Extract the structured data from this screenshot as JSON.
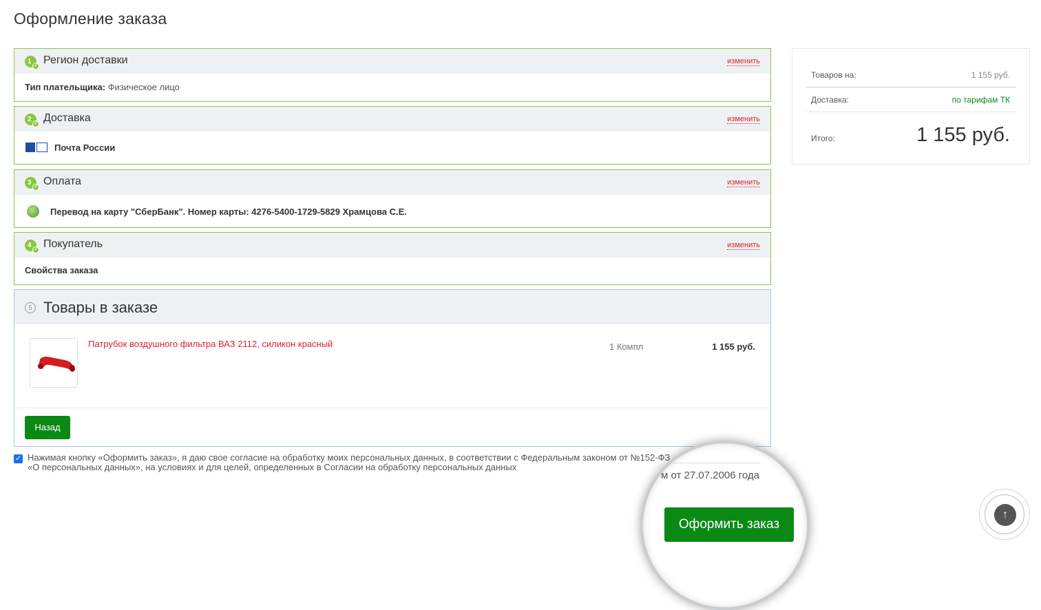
{
  "page": {
    "title": "Оформление заказа"
  },
  "steps": {
    "region": {
      "num": "1",
      "title": "Регион доставки",
      "edit": "изменить",
      "payer_label": "Тип плательщика:",
      "payer_value": "Физическое лицо"
    },
    "delivery": {
      "num": "2",
      "title": "Доставка",
      "edit": "изменить",
      "service": "Почта России"
    },
    "payment": {
      "num": "3",
      "title": "Оплата",
      "edit": "изменить",
      "method": "Перевод на карту \"СберБанк\". Номер карты: 4276-5400-1729-5829 Храмцова С.Е."
    },
    "buyer": {
      "num": "4",
      "title": "Покупатель",
      "edit": "изменить",
      "props": "Свойства заказа"
    }
  },
  "goods": {
    "num": "5",
    "title": "Товары в заказе",
    "items": [
      {
        "name": "Патрубок воздушного фильтра ВАЗ 2112, силикон красный",
        "qty": "1 Компл",
        "price": "1 155 руб."
      }
    ],
    "back_label": "Назад"
  },
  "consent": {
    "checked": true,
    "text": "Нажимая кнопку «Оформить заказ», я даю свое согласие на обработку моих персональных данных, в соответствии с Федеральным законом от №152-ФЗ «О персональных данных», на условиях и для целей, определенных в Согласии на обработку персональных данных"
  },
  "summary": {
    "goods_label": "Товаров на:",
    "goods_value": "1 155 руб.",
    "delivery_label": "Доставка:",
    "delivery_value": "по тарифам ТК",
    "total_label": "Итого:",
    "total_value": "1 155 руб."
  },
  "magnifier": {
    "law_fragment": "м от 27.07.2006 года",
    "order_label": "Оформить заказ"
  },
  "icons": {
    "check": "✓",
    "arrow_up": "🡑"
  },
  "colors": {
    "accent_green": "#0a8a15",
    "step_green": "#8cc63f",
    "link_red": "#d9232d"
  }
}
